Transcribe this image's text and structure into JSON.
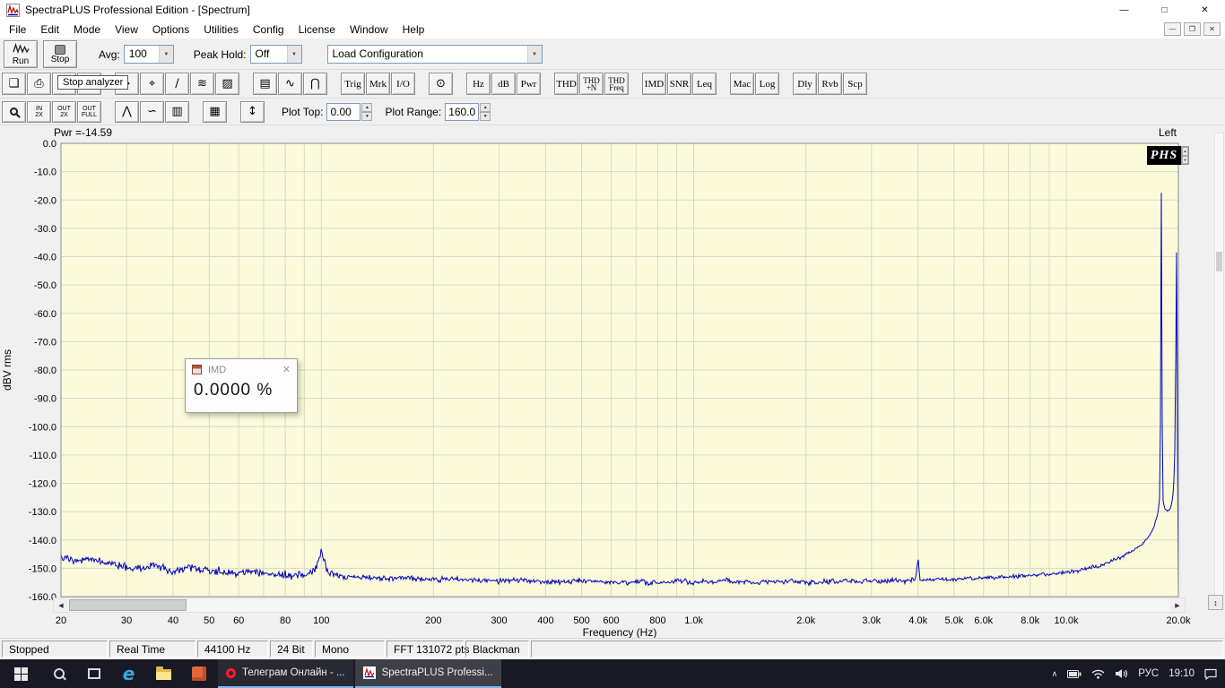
{
  "titlebar": {
    "title": "SpectraPLUS Professional Edition - [Spectrum]",
    "minimize": "—",
    "maximize": "□",
    "close": "✕"
  },
  "menubar": {
    "items": [
      "File",
      "Edit",
      "Mode",
      "View",
      "Options",
      "Utilities",
      "Config",
      "License",
      "Window",
      "Help"
    ],
    "mdi_minimize": "—",
    "mdi_restore": "❐",
    "mdi_close": "✕"
  },
  "toolbar_main": {
    "run_label": "Run",
    "stop_label": "Stop",
    "avg_label": "Avg:",
    "avg_value": "100",
    "peak_hold_label": "Peak Hold:",
    "peak_hold_value": "Off",
    "load_config_value": "Load Configuration"
  },
  "tooltip_text": "Stop analyzer",
  "toolbar_tools": {
    "groups": [
      {
        "buttons": [
          {
            "name": "new-file-icon",
            "glyph": "❏"
          },
          {
            "name": "print-icon",
            "glyph": "⎙"
          },
          {
            "name": "load-config-icon",
            "glyph": "◫"
          },
          {
            "name": "save-config-icon",
            "glyph": "◪"
          }
        ]
      },
      {
        "buttons": [
          {
            "name": "fast-average-icon",
            "glyph": "»"
          },
          {
            "name": "zoom-waveform-icon",
            "glyph": "⌖"
          },
          {
            "name": "phase-slope-icon",
            "glyph": "∕"
          },
          {
            "name": "waterfall-icon",
            "glyph": "≋"
          },
          {
            "name": "spectrogram-icon",
            "glyph": "▨"
          }
        ]
      },
      {
        "buttons": [
          {
            "name": "time-series-icon",
            "glyph": "▤"
          },
          {
            "name": "scope-trace-icon",
            "glyph": "∿"
          },
          {
            "name": "distribution-icon",
            "glyph": "⋂"
          }
        ]
      },
      {
        "buttons": [
          {
            "name": "trigger-button",
            "label": "Trig"
          },
          {
            "name": "marker-button",
            "label": "Mrk"
          },
          {
            "name": "io-button",
            "label": "I/O"
          }
        ]
      },
      {
        "buttons": [
          {
            "name": "signal-generator-icon",
            "glyph": "⊙"
          }
        ]
      },
      {
        "buttons": [
          {
            "name": "hz-button",
            "label": "Hz"
          },
          {
            "name": "db-button",
            "label": "dB"
          },
          {
            "name": "pwr-button",
            "label": "Pwr"
          }
        ]
      },
      {
        "buttons": [
          {
            "name": "thd-button",
            "label": "THD"
          },
          {
            "name": "thd-n-button",
            "lines": [
              "THD",
              "+N"
            ]
          },
          {
            "name": "thd-freq-button",
            "lines": [
              "THD",
              "Freq"
            ]
          }
        ]
      },
      {
        "buttons": [
          {
            "name": "imd-button",
            "label": "IMD"
          },
          {
            "name": "snr-button",
            "label": "SNR"
          },
          {
            "name": "leq-button",
            "label": "Leq"
          }
        ]
      },
      {
        "buttons": [
          {
            "name": "macro-button",
            "label": "Mac"
          },
          {
            "name": "log-button",
            "label": "Log"
          }
        ]
      },
      {
        "buttons": [
          {
            "name": "delay-button",
            "label": "Dly"
          },
          {
            "name": "reverb-button",
            "label": "Rvb"
          },
          {
            "name": "scope-button",
            "label": "Scp"
          }
        ]
      }
    ]
  },
  "toolbar_zoom": {
    "groups": [
      {
        "buttons": [
          {
            "name": "zoom-select-button",
            "mag": true
          },
          {
            "name": "zoom-in-2x-button",
            "lines": [
              "IN",
              "2X"
            ]
          },
          {
            "name": "zoom-out-2x-button",
            "lines": [
              "OUT",
              "2X"
            ]
          },
          {
            "name": "zoom-out-full-button",
            "lines": [
              "OUT",
              "FULL"
            ]
          }
        ]
      },
      {
        "buttons": [
          {
            "name": "peak-curve-icon",
            "glyph": "⋀"
          },
          {
            "name": "smooth-curve-icon",
            "glyph": "∽"
          },
          {
            "name": "bar-display-icon",
            "glyph": "▥"
          }
        ]
      },
      {
        "buttons": [
          {
            "name": "data-table-icon",
            "glyph": "▦"
          }
        ]
      },
      {
        "buttons": [
          {
            "name": "vertical-scale-icon",
            "glyph": "↕"
          }
        ]
      }
    ],
    "plot_top_label": "Plot Top:",
    "plot_top_value": "0.00",
    "plot_range_label": "Plot Range:",
    "plot_range_value": "160.0"
  },
  "chart": {
    "pwr_text": "Pwr =-14.59",
    "channel_label": "Left",
    "logo_text": "PHS"
  },
  "imd_window": {
    "title": "IMD",
    "close": "✕",
    "value": "0.0000 %"
  },
  "chart_data": {
    "type": "line",
    "x_scale": "log",
    "xlim": [
      20,
      20000
    ],
    "ylim": [
      -160,
      0
    ],
    "y_tick_step": 10,
    "xlabel": "Frequency (Hz)",
    "ylabel": "dBV rms",
    "plot_bg": "#fbfbdc",
    "grid_color": "#d8d8c4",
    "x_ticks": [
      {
        "f": 20,
        "label": "20"
      },
      {
        "f": 30,
        "label": "30"
      },
      {
        "f": 40,
        "label": "40"
      },
      {
        "f": 50,
        "label": "50"
      },
      {
        "f": 60,
        "label": "60"
      },
      {
        "f": 70,
        "label": ""
      },
      {
        "f": 80,
        "label": "80"
      },
      {
        "f": 90,
        "label": ""
      },
      {
        "f": 100,
        "label": "100"
      },
      {
        "f": 200,
        "label": "200"
      },
      {
        "f": 300,
        "label": "300"
      },
      {
        "f": 400,
        "label": "400"
      },
      {
        "f": 500,
        "label": "500"
      },
      {
        "f": 600,
        "label": "600"
      },
      {
        "f": 700,
        "label": ""
      },
      {
        "f": 800,
        "label": "800"
      },
      {
        "f": 900,
        "label": ""
      },
      {
        "f": 1000,
        "label": "1.0k"
      },
      {
        "f": 2000,
        "label": "2.0k"
      },
      {
        "f": 3000,
        "label": "3.0k"
      },
      {
        "f": 4000,
        "label": "4.0k"
      },
      {
        "f": 5000,
        "label": "5.0k"
      },
      {
        "f": 6000,
        "label": "6.0k"
      },
      {
        "f": 7000,
        "label": ""
      },
      {
        "f": 8000,
        "label": "8.0k"
      },
      {
        "f": 9000,
        "label": ""
      },
      {
        "f": 10000,
        "label": "10.0k"
      },
      {
        "f": 20000,
        "label": "20.0k"
      }
    ],
    "series": [
      {
        "name": "Left",
        "color": "#0000bb",
        "anchors": [
          [
            20,
            -146
          ],
          [
            22,
            -148
          ],
          [
            24,
            -146.5
          ],
          [
            27,
            -148.5
          ],
          [
            30,
            -149.5
          ],
          [
            33,
            -150.5
          ],
          [
            36,
            -149
          ],
          [
            40,
            -151
          ],
          [
            45,
            -150
          ],
          [
            50,
            -151
          ],
          [
            55,
            -151.5
          ],
          [
            60,
            -152
          ],
          [
            65,
            -151
          ],
          [
            70,
            -152
          ],
          [
            80,
            -152.5
          ],
          [
            90,
            -152.5
          ],
          [
            96,
            -151
          ],
          [
            100,
            -144
          ],
          [
            104,
            -151.5
          ],
          [
            115,
            -153
          ],
          [
            130,
            -153
          ],
          [
            150,
            -153.5
          ],
          [
            175,
            -153.5
          ],
          [
            200,
            -154
          ],
          [
            250,
            -154
          ],
          [
            300,
            -154.5
          ],
          [
            350,
            -154
          ],
          [
            400,
            -155
          ],
          [
            450,
            -154.5
          ],
          [
            500,
            -154.5
          ],
          [
            600,
            -155
          ],
          [
            700,
            -155
          ],
          [
            800,
            -155
          ],
          [
            900,
            -154.5
          ],
          [
            1000,
            -155
          ],
          [
            1200,
            -154.5
          ],
          [
            1500,
            -155
          ],
          [
            1800,
            -154.5
          ],
          [
            2000,
            -155
          ],
          [
            2500,
            -154.5
          ],
          [
            3000,
            -154.5
          ],
          [
            3500,
            -154.5
          ],
          [
            3950,
            -154
          ],
          [
            4000,
            -146.5
          ],
          [
            4050,
            -154
          ],
          [
            4500,
            -154
          ],
          [
            5000,
            -154
          ],
          [
            5500,
            -153.5
          ],
          [
            6000,
            -153.5
          ],
          [
            7000,
            -153
          ],
          [
            8000,
            -152.5
          ],
          [
            9000,
            -152
          ],
          [
            10000,
            -151.5
          ],
          [
            11000,
            -150.5
          ],
          [
            12000,
            -149.5
          ],
          [
            13000,
            -148
          ],
          [
            14000,
            -146
          ],
          [
            15000,
            -144
          ],
          [
            16000,
            -141.5
          ],
          [
            16700,
            -138.5
          ],
          [
            17200,
            -135.5
          ],
          [
            17600,
            -131
          ],
          [
            17800,
            -126
          ],
          [
            17900,
            -100
          ],
          [
            17960,
            -48
          ],
          [
            18000,
            -17.5
          ],
          [
            18040,
            -48
          ],
          [
            18100,
            -100
          ],
          [
            18200,
            -126
          ],
          [
            18400,
            -129
          ],
          [
            18700,
            -130
          ],
          [
            19000,
            -129
          ],
          [
            19200,
            -127
          ],
          [
            19400,
            -123
          ],
          [
            19550,
            -112
          ],
          [
            19680,
            -75
          ],
          [
            19780,
            -38.5
          ],
          [
            19850,
            -75
          ],
          [
            19900,
            -112
          ],
          [
            19940,
            -138
          ],
          [
            19970,
            -150
          ],
          [
            20000,
            -159
          ]
        ]
      }
    ]
  },
  "statusbar": {
    "items": [
      "Stopped",
      "Real Time",
      "44100 Hz",
      "24 Bit",
      "Mono",
      "FFT 131072 pts",
      "Blackman"
    ]
  },
  "taskbar": {
    "left_icons": [
      "start-button",
      "search-button",
      "task-view-button",
      "edge-button",
      "explorer-button",
      "app-shortcut-button"
    ],
    "tasks": [
      {
        "label": "Телеграм Онлайн - ...",
        "icon": "opera-icon",
        "active": false
      },
      {
        "label": "SpectraPLUS Professi...",
        "icon": "spectraplus-icon",
        "active": true
      }
    ],
    "tray_icons": [
      "chevron-up-icon",
      "battery-icon",
      "network-icon",
      "volume-icon",
      "action-center-icon"
    ],
    "language": "РУС",
    "time": "19:10"
  }
}
